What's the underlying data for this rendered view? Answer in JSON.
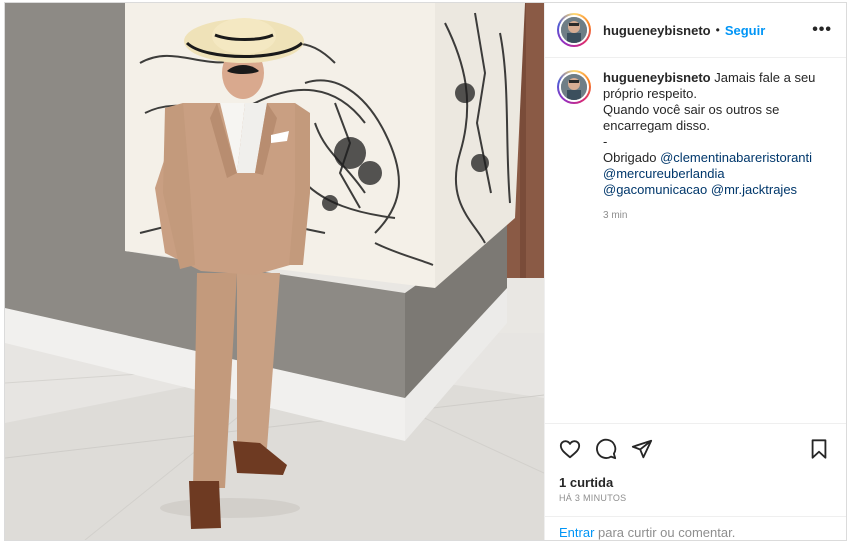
{
  "post": {
    "username": "hugueneybisneto",
    "separator": "•",
    "follow_label": "Seguir",
    "more_icon": "more-options-icon"
  },
  "caption": {
    "username": "hugueneybisneto",
    "line1": "Jamais fale a seu próprio respeito.",
    "line2": "Quando você sair os outros se encarregam disso.",
    "line3": "-",
    "thanks": "Obrigado",
    "mention1": "@clementinabareristoranti",
    "mention2": "@mercureuberlandia",
    "mention3": "@gacomunicacao",
    "mention4": "@mr.jacktrajes",
    "time": "3 min"
  },
  "actions": {
    "icons": [
      "heart-icon",
      "comment-icon",
      "share-icon",
      "bookmark-icon"
    ],
    "likes": "1 curtida",
    "timestamp": "HÁ 3 MINUTOS"
  },
  "login_prompt": {
    "link": "Entrar",
    "text": " para curtir ou comentar."
  },
  "colors": {
    "link_blue": "#0095f6",
    "mention_blue": "#00376b",
    "suit": "#c89e80",
    "muted": "#8e8e8e"
  }
}
